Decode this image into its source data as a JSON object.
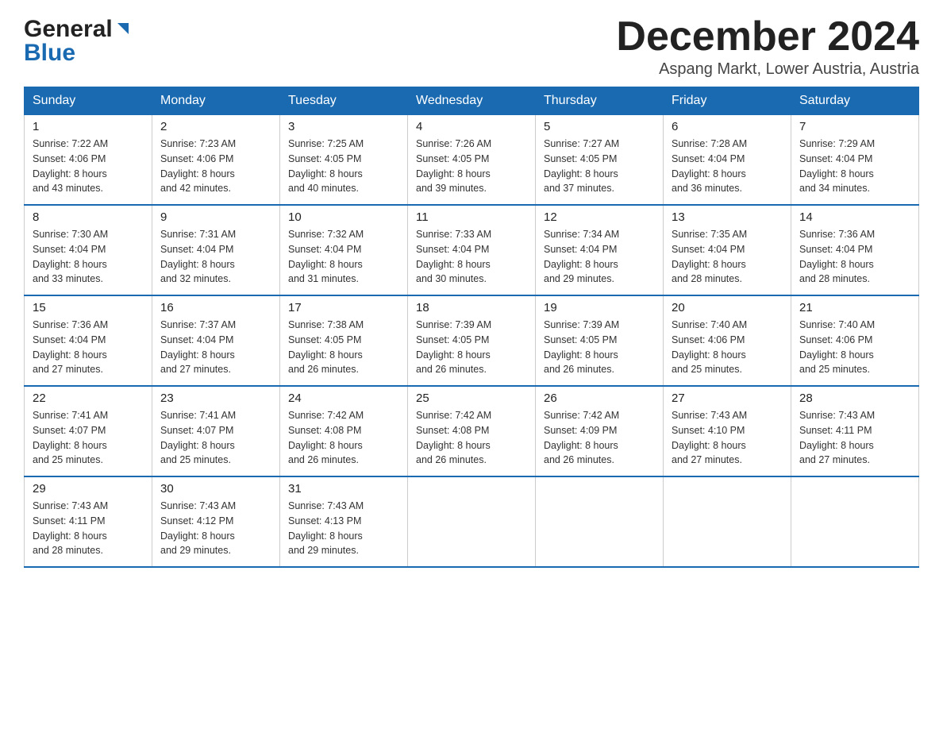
{
  "header": {
    "month_title": "December 2024",
    "location": "Aspang Markt, Lower Austria, Austria",
    "logo_general": "General",
    "logo_blue": "Blue"
  },
  "weekdays": [
    "Sunday",
    "Monday",
    "Tuesday",
    "Wednesday",
    "Thursday",
    "Friday",
    "Saturday"
  ],
  "weeks": [
    [
      {
        "day": "1",
        "sunrise": "7:22 AM",
        "sunset": "4:06 PM",
        "daylight": "8 hours and 43 minutes."
      },
      {
        "day": "2",
        "sunrise": "7:23 AM",
        "sunset": "4:06 PM",
        "daylight": "8 hours and 42 minutes."
      },
      {
        "day": "3",
        "sunrise": "7:25 AM",
        "sunset": "4:05 PM",
        "daylight": "8 hours and 40 minutes."
      },
      {
        "day": "4",
        "sunrise": "7:26 AM",
        "sunset": "4:05 PM",
        "daylight": "8 hours and 39 minutes."
      },
      {
        "day": "5",
        "sunrise": "7:27 AM",
        "sunset": "4:05 PM",
        "daylight": "8 hours and 37 minutes."
      },
      {
        "day": "6",
        "sunrise": "7:28 AM",
        "sunset": "4:04 PM",
        "daylight": "8 hours and 36 minutes."
      },
      {
        "day": "7",
        "sunrise": "7:29 AM",
        "sunset": "4:04 PM",
        "daylight": "8 hours and 34 minutes."
      }
    ],
    [
      {
        "day": "8",
        "sunrise": "7:30 AM",
        "sunset": "4:04 PM",
        "daylight": "8 hours and 33 minutes."
      },
      {
        "day": "9",
        "sunrise": "7:31 AM",
        "sunset": "4:04 PM",
        "daylight": "8 hours and 32 minutes."
      },
      {
        "day": "10",
        "sunrise": "7:32 AM",
        "sunset": "4:04 PM",
        "daylight": "8 hours and 31 minutes."
      },
      {
        "day": "11",
        "sunrise": "7:33 AM",
        "sunset": "4:04 PM",
        "daylight": "8 hours and 30 minutes."
      },
      {
        "day": "12",
        "sunrise": "7:34 AM",
        "sunset": "4:04 PM",
        "daylight": "8 hours and 29 minutes."
      },
      {
        "day": "13",
        "sunrise": "7:35 AM",
        "sunset": "4:04 PM",
        "daylight": "8 hours and 28 minutes."
      },
      {
        "day": "14",
        "sunrise": "7:36 AM",
        "sunset": "4:04 PM",
        "daylight": "8 hours and 28 minutes."
      }
    ],
    [
      {
        "day": "15",
        "sunrise": "7:36 AM",
        "sunset": "4:04 PM",
        "daylight": "8 hours and 27 minutes."
      },
      {
        "day": "16",
        "sunrise": "7:37 AM",
        "sunset": "4:04 PM",
        "daylight": "8 hours and 27 minutes."
      },
      {
        "day": "17",
        "sunrise": "7:38 AM",
        "sunset": "4:05 PM",
        "daylight": "8 hours and 26 minutes."
      },
      {
        "day": "18",
        "sunrise": "7:39 AM",
        "sunset": "4:05 PM",
        "daylight": "8 hours and 26 minutes."
      },
      {
        "day": "19",
        "sunrise": "7:39 AM",
        "sunset": "4:05 PM",
        "daylight": "8 hours and 26 minutes."
      },
      {
        "day": "20",
        "sunrise": "7:40 AM",
        "sunset": "4:06 PM",
        "daylight": "8 hours and 25 minutes."
      },
      {
        "day": "21",
        "sunrise": "7:40 AM",
        "sunset": "4:06 PM",
        "daylight": "8 hours and 25 minutes."
      }
    ],
    [
      {
        "day": "22",
        "sunrise": "7:41 AM",
        "sunset": "4:07 PM",
        "daylight": "8 hours and 25 minutes."
      },
      {
        "day": "23",
        "sunrise": "7:41 AM",
        "sunset": "4:07 PM",
        "daylight": "8 hours and 25 minutes."
      },
      {
        "day": "24",
        "sunrise": "7:42 AM",
        "sunset": "4:08 PM",
        "daylight": "8 hours and 26 minutes."
      },
      {
        "day": "25",
        "sunrise": "7:42 AM",
        "sunset": "4:08 PM",
        "daylight": "8 hours and 26 minutes."
      },
      {
        "day": "26",
        "sunrise": "7:42 AM",
        "sunset": "4:09 PM",
        "daylight": "8 hours and 26 minutes."
      },
      {
        "day": "27",
        "sunrise": "7:43 AM",
        "sunset": "4:10 PM",
        "daylight": "8 hours and 27 minutes."
      },
      {
        "day": "28",
        "sunrise": "7:43 AM",
        "sunset": "4:11 PM",
        "daylight": "8 hours and 27 minutes."
      }
    ],
    [
      {
        "day": "29",
        "sunrise": "7:43 AM",
        "sunset": "4:11 PM",
        "daylight": "8 hours and 28 minutes."
      },
      {
        "day": "30",
        "sunrise": "7:43 AM",
        "sunset": "4:12 PM",
        "daylight": "8 hours and 29 minutes."
      },
      {
        "day": "31",
        "sunrise": "7:43 AM",
        "sunset": "4:13 PM",
        "daylight": "8 hours and 29 minutes."
      },
      null,
      null,
      null,
      null
    ]
  ],
  "labels": {
    "sunrise": "Sunrise:",
    "sunset": "Sunset:",
    "daylight": "Daylight:"
  }
}
